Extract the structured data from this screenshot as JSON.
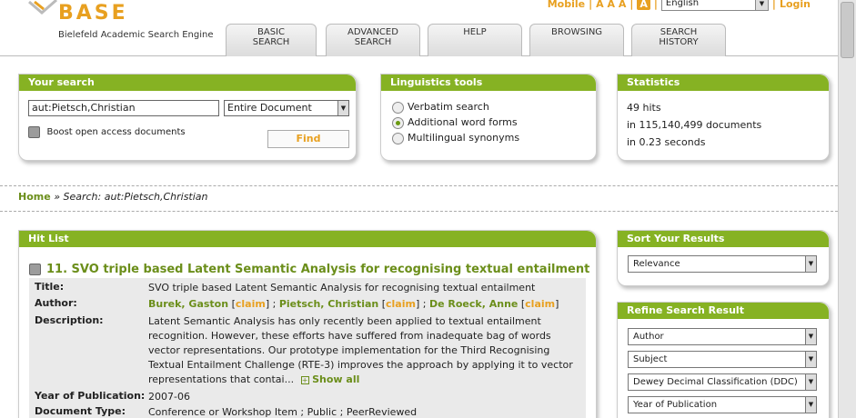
{
  "header": {
    "logo": "BASE",
    "logo_sub": "Bielefeld Academic Search Engine",
    "tabs": [
      {
        "line1": "BASIC",
        "line2": "SEARCH"
      },
      {
        "line1": "ADVANCED",
        "line2": "SEARCH"
      },
      {
        "line1": "HELP",
        "line2": ""
      },
      {
        "line1": "BROWSING",
        "line2": ""
      },
      {
        "line1": "SEARCH",
        "line2": "HISTORY"
      }
    ],
    "mobile": "Mobile",
    "font_sizes": "A A A",
    "a_box": "A",
    "language": "English",
    "login": "Login",
    "sep": "|"
  },
  "search": {
    "title": "Your search",
    "query": "aut:Pietsch,Christian",
    "scope": "Entire Document",
    "boost_label": "Boost open access documents",
    "find_button": "Find"
  },
  "linguistics": {
    "title": "Linguistics tools",
    "options": [
      "Verbatim search",
      "Additional word forms",
      "Multilingual synonyms"
    ]
  },
  "statistics": {
    "title": "Statistics",
    "hits": "49 hits",
    "documents": "in 115,140,499 documents",
    "time": "in 0.23 seconds"
  },
  "breadcrumb": {
    "home": "Home",
    "sep": "»",
    "current": "Search: aut:Pietsch,Christian"
  },
  "hitlist": {
    "title": "Hit List",
    "item_title": "11. SVO triple based Latent Semantic Analysis for recognising textual entailment",
    "labels": {
      "title": "Title:",
      "author": "Author:",
      "description": "Description:",
      "year": "Year of Publication:",
      "doctype": "Document Type:"
    },
    "title_value": "SVO triple based Latent Semantic Analysis for recognising textual entailment",
    "authors": [
      {
        "name": "Burek, Gaston",
        "claim": "claim"
      },
      {
        "name": "Pietsch, Christian",
        "claim": "claim"
      },
      {
        "name": "De Roeck, Anne",
        "claim": "claim"
      }
    ],
    "description": "Latent Semantic Analysis has only recently been applied to textual entailment recognition. However, these efforts have suffered from inadequate bag of words vector representations. Our prototype implementation for the Third Recognising Textual Entailment Challenge (RTE-3) improves the approach by applying it to vector representations that contai...",
    "show_all": "Show all",
    "year_value": "2007-06",
    "doctype_value": "Conference or Workshop Item ; Public ; PeerReviewed"
  },
  "sort": {
    "title": "Sort Your Results",
    "value": "Relevance"
  },
  "refine": {
    "title": "Refine Search Result",
    "filters": [
      "Author",
      "Subject",
      "Dewey Decimal Classification (DDC)",
      "Year of Publication"
    ]
  },
  "colors": {
    "accent_green": "#86b223",
    "accent_orange": "#e8a020"
  }
}
